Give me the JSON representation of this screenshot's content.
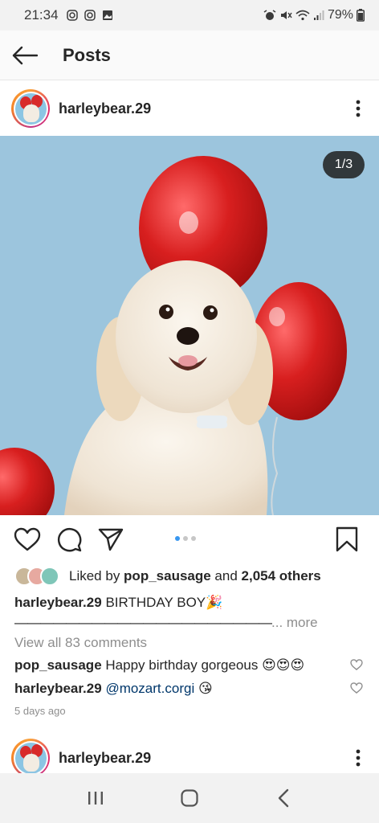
{
  "status_bar": {
    "time": "21:34",
    "battery": "79%",
    "icons": [
      "instagram-icon",
      "instagram-icon",
      "gallery-icon",
      "alarm-icon",
      "mute-icon",
      "wifi-icon",
      "signal-icon",
      "battery-icon"
    ]
  },
  "app_bar": {
    "title": "Posts",
    "back_icon": "arrow-left-icon"
  },
  "post": {
    "username": "harleybear.29",
    "image_counter": "1/3",
    "carousel": {
      "total": 3,
      "active": 1
    },
    "likes": {
      "prefix": "Liked by ",
      "liker": "pop_sausage",
      "middle": " and ",
      "others": "2,054 others"
    },
    "caption": {
      "username": "harleybear.29",
      "text": "BIRTHDAY BOY🎉",
      "dashes": "————————————————————",
      "more": "... more"
    },
    "view_comments": "View all 83 comments",
    "comments": [
      {
        "username": "pop_sausage",
        "text": "Happy birthday gorgeous 😍😍😍"
      },
      {
        "username": "harleybear.29",
        "mention": "@mozart.corgi",
        "text": "😘"
      }
    ],
    "timestamp": "5 days ago"
  },
  "next_post": {
    "username": "harleybear.29"
  },
  "colors": {
    "accent_blue": "#3897f0",
    "balloon_red": "#d42222",
    "sky_blue": "#9cc5dd"
  }
}
